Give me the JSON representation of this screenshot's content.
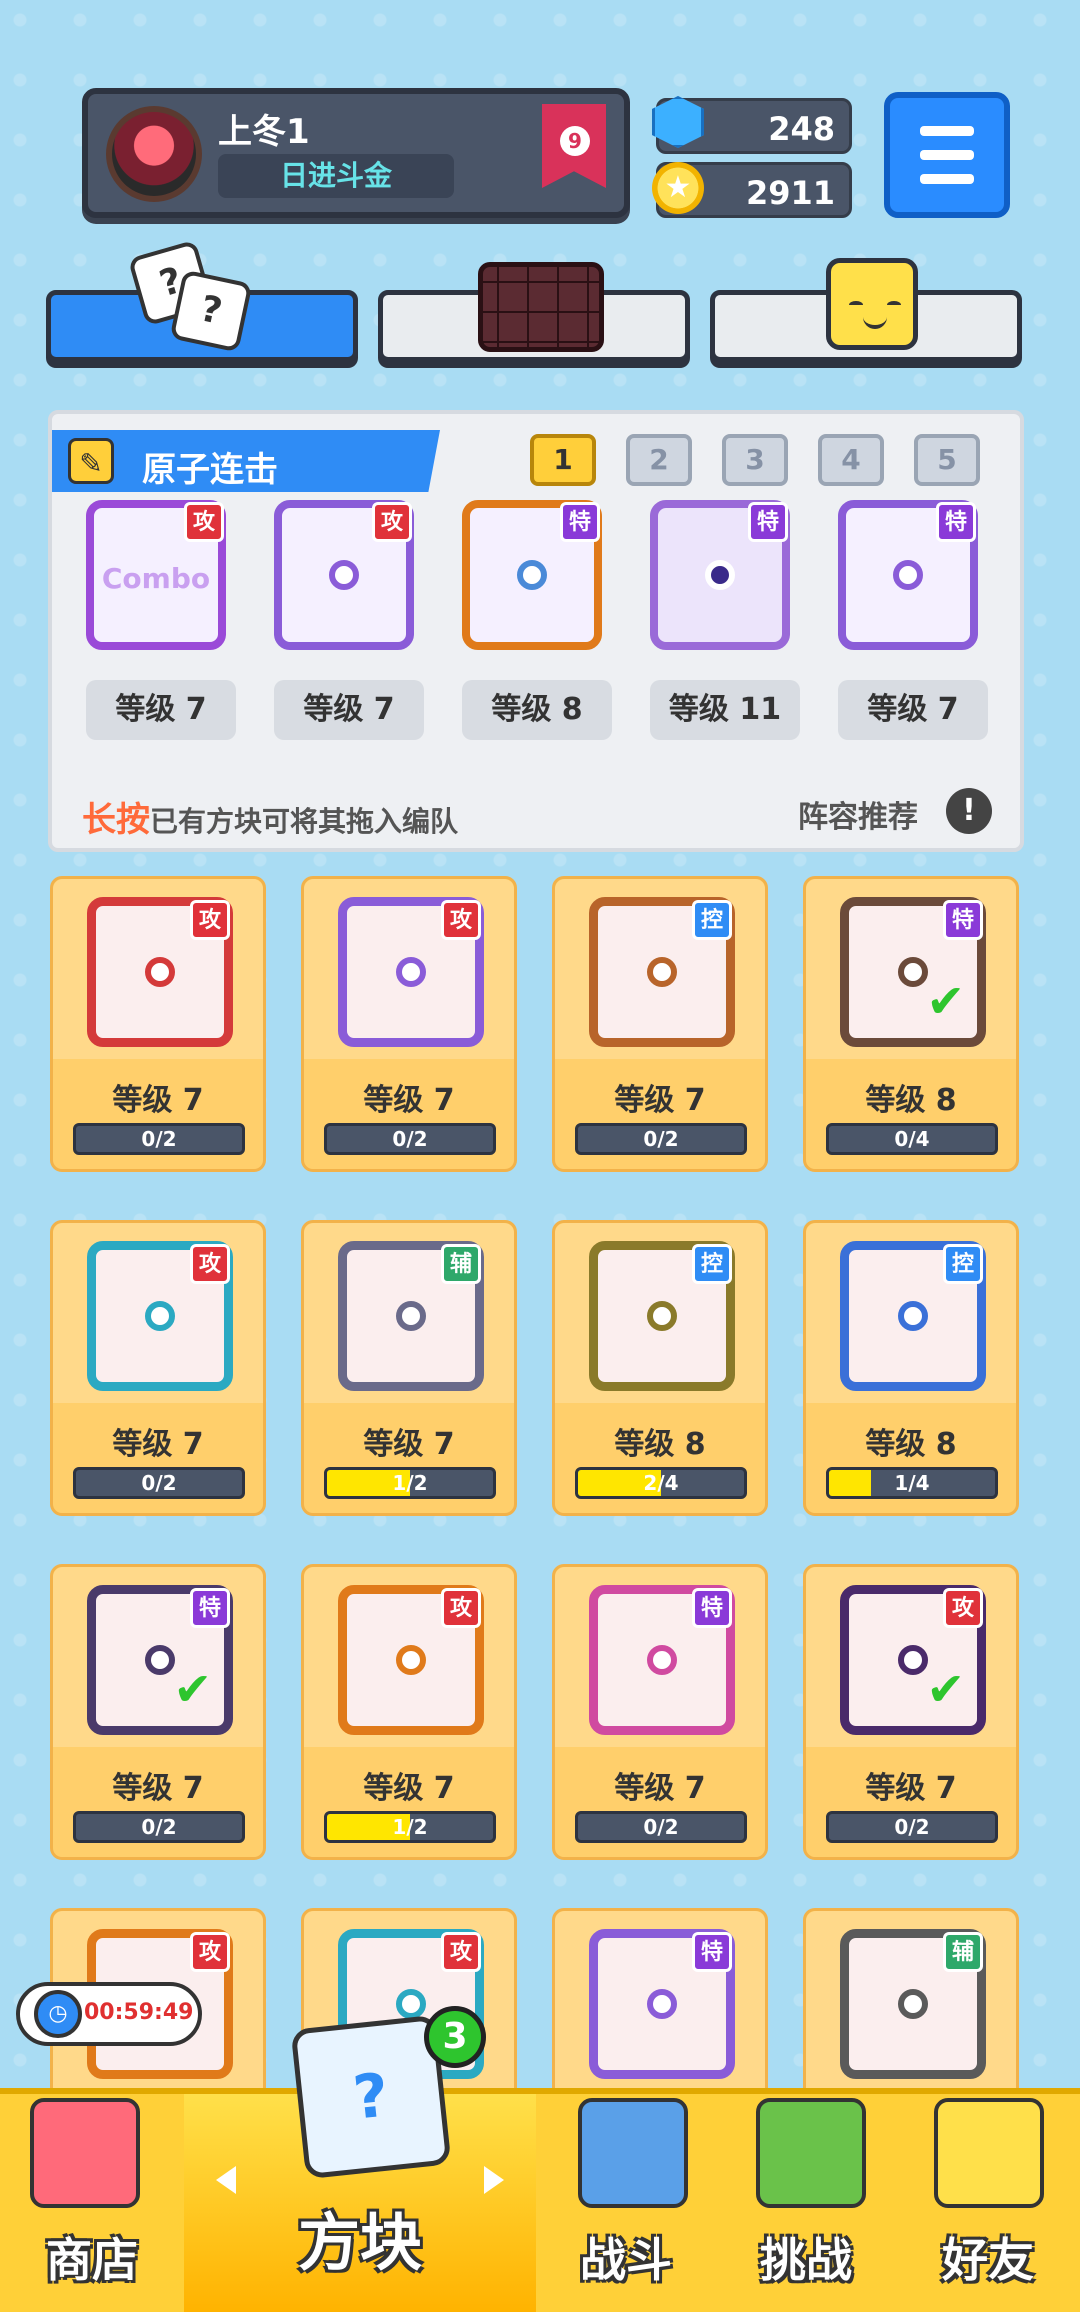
{
  "profile": {
    "name": "上冬1",
    "title": "日进斗金",
    "rank": "9"
  },
  "currency": {
    "gems": "248",
    "coins": "2911"
  },
  "tabs": [
    {
      "name": "dice",
      "active": true
    },
    {
      "name": "chocolate",
      "active": false
    },
    {
      "name": "emoji",
      "active": false
    }
  ],
  "team": {
    "title": "原子连击",
    "slots": [
      "1",
      "2",
      "3",
      "4",
      "5"
    ],
    "active_slot": "1",
    "members": [
      {
        "type": "攻",
        "level": "等级 7",
        "overlay": "Combo"
      },
      {
        "type": "攻",
        "level": "等级 7"
      },
      {
        "type": "特",
        "level": "等级 8"
      },
      {
        "type": "特",
        "level": "等级 11"
      },
      {
        "type": "特",
        "level": "等级 7"
      }
    ],
    "hint_emphasis": "长按",
    "hint_text": "已有方块可将其拖入编队",
    "recommend": "阵容推荐",
    "info": "!"
  },
  "cards": [
    {
      "type": "攻",
      "level": "等级 7",
      "progress": "0/2",
      "fill": 0,
      "frame": "#d43a3a",
      "check": false
    },
    {
      "type": "攻",
      "level": "等级 7",
      "progress": "0/2",
      "fill": 0,
      "frame": "#8a5cd8",
      "check": false
    },
    {
      "type": "控",
      "level": "等级 7",
      "progress": "0/2",
      "fill": 0,
      "frame": "#b8642a",
      "check": false
    },
    {
      "type": "特",
      "level": "等级 8",
      "progress": "0/4",
      "fill": 0,
      "frame": "#6b4a3a",
      "check": true
    },
    {
      "type": "攻",
      "level": "等级 7",
      "progress": "0/2",
      "fill": 0,
      "frame": "#2ba9c2",
      "check": false
    },
    {
      "type": "辅",
      "level": "等级 7",
      "progress": "1/2",
      "fill": 0.5,
      "frame": "#6a6a8a",
      "check": false
    },
    {
      "type": "控",
      "level": "等级 8",
      "progress": "2/4",
      "fill": 0.5,
      "frame": "#8a7a2a",
      "check": false
    },
    {
      "type": "控",
      "level": "等级 8",
      "progress": "1/4",
      "fill": 0.25,
      "frame": "#3a70d8",
      "check": false
    },
    {
      "type": "特",
      "level": "等级 7",
      "progress": "0/2",
      "fill": 0,
      "frame": "#4a3a6a",
      "check": true
    },
    {
      "type": "攻",
      "level": "等级 7",
      "progress": "1/2",
      "fill": 0.5,
      "frame": "#e07a1a",
      "check": false
    },
    {
      "type": "特",
      "level": "等级 7",
      "progress": "0/2",
      "fill": 0,
      "frame": "#d04aa0",
      "check": false
    },
    {
      "type": "攻",
      "level": "等级 7",
      "progress": "0/2",
      "fill": 0,
      "frame": "#4a2a6a",
      "check": true
    },
    {
      "type": "攻",
      "frame": "#e07a1a"
    },
    {
      "type": "攻",
      "frame": "#2ba9c2"
    },
    {
      "type": "特",
      "frame": "#8a5cd8"
    },
    {
      "type": "辅",
      "frame": "#5a5a5a"
    }
  ],
  "type_colors": {
    "攻": "#e0323a",
    "特": "#8a3ad8",
    "控": "#2f8cf5",
    "辅": "#2ea86a"
  },
  "timer": "00:59:49",
  "center_badge": "3",
  "nav": {
    "shop": "商店",
    "blocks": "方块",
    "battle": "战斗",
    "challenge": "挑战",
    "friends": "好友"
  }
}
